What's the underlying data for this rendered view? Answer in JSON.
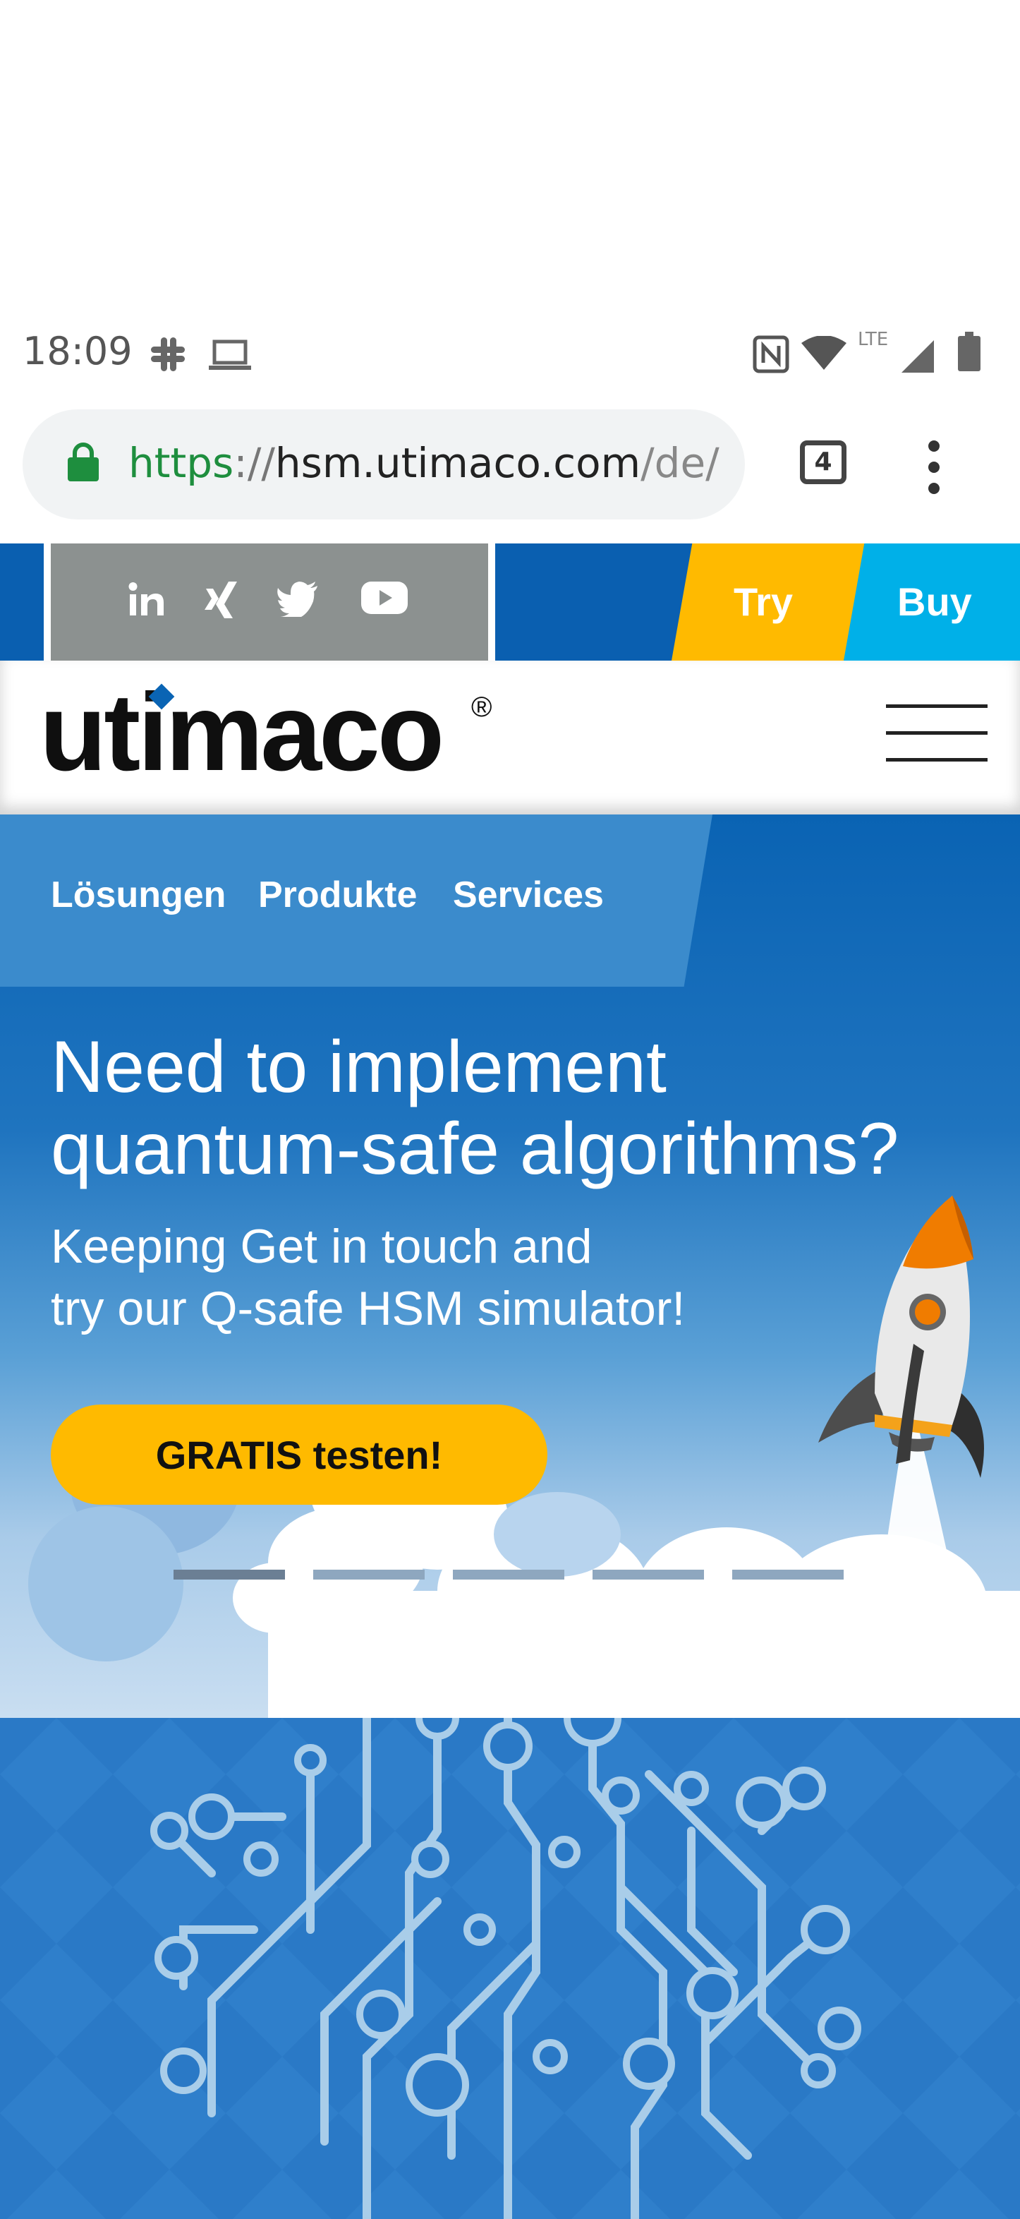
{
  "status_bar": {
    "time": "18:09",
    "network_label": "LTE"
  },
  "browser": {
    "url_scheme": "https",
    "url_separator": "://",
    "url_host": "hsm.utimaco.com",
    "url_path": "/de/",
    "tab_count": "4"
  },
  "topbar": {
    "social_icons": [
      "linkedin-icon",
      "xing-icon",
      "twitter-icon",
      "youtube-icon"
    ],
    "try_label": "Try",
    "buy_label": "Buy",
    "colors": {
      "bar": "#0a5fb0",
      "social_box": "#8c9190",
      "try": "#ffba00",
      "buy": "#00b0e8"
    }
  },
  "header": {
    "logo_text": "utimaco",
    "logo_mark": "®"
  },
  "nav": {
    "items": [
      "Lösungen",
      "Produkte",
      "Services"
    ]
  },
  "hero": {
    "headline_line1": "Need to implement",
    "headline_line2": "quantum-safe algorithms?",
    "subline_line1": "Keeping Get in touch and",
    "subline_line2": "try our Q-safe HSM simulator!",
    "cta_label": "GRATIS testen!",
    "cta_color": "#ffba00"
  }
}
